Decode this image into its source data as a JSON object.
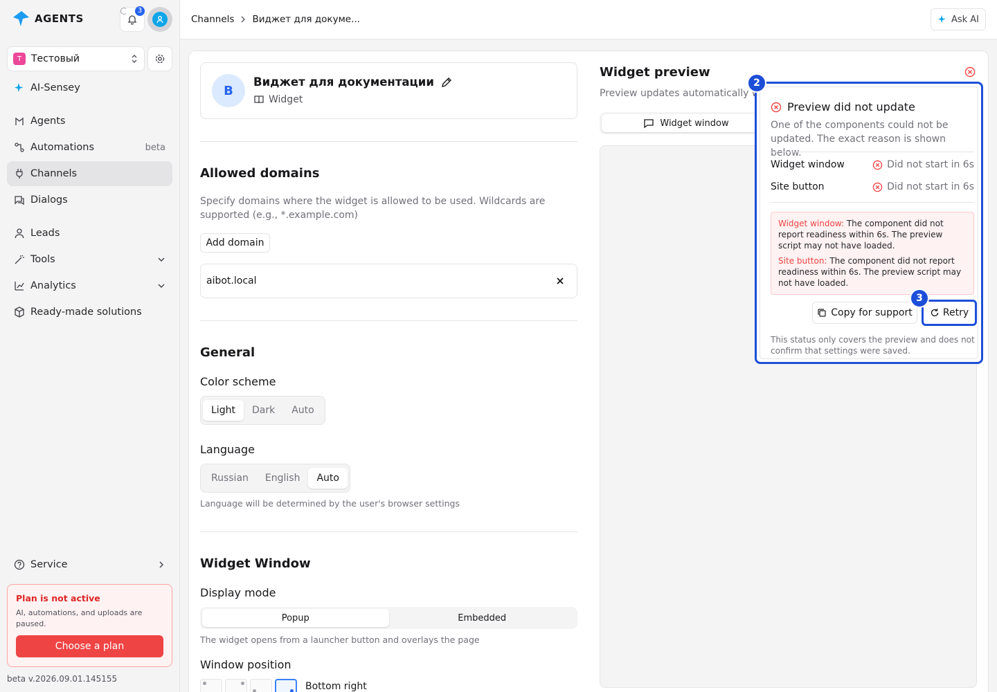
{
  "app": {
    "logo_text": "AGENTS",
    "notifications_count": "3"
  },
  "workspace": {
    "initial": "Т",
    "name": "Тестовый"
  },
  "sidebar": {
    "items": [
      {
        "label": "AI-Sensey",
        "icon": "sparkle-icon"
      },
      {
        "label": "Agents",
        "icon": "agents-icon"
      },
      {
        "label": "Automations",
        "icon": "automations-icon",
        "suffix": "beta"
      },
      {
        "label": "Channels",
        "icon": "channels-icon",
        "active": true
      },
      {
        "label": "Dialogs",
        "icon": "dialogs-icon"
      },
      {
        "label": "Leads",
        "icon": "user-icon"
      },
      {
        "label": "Tools",
        "icon": "wand-icon"
      },
      {
        "label": "Analytics",
        "icon": "chart-icon"
      },
      {
        "label": "Ready-made solutions",
        "icon": "box-icon"
      }
    ],
    "service": "Service",
    "plan": {
      "title": "Plan is not active",
      "description": "AI, automations, and uploads are paused.",
      "button": "Choose a plan"
    },
    "version": "beta v.2026.09.01.145155"
  },
  "header": {
    "breadcrumb_1": "Channels",
    "breadcrumb_2": "Виджет для докуме...",
    "ask_ai": "Ask AI"
  },
  "widget": {
    "avatar_letter": "В",
    "name": "Виджет для документации",
    "type": "Widget"
  },
  "allowed_domains": {
    "title": "Allowed domains",
    "description": "Specify domains where the widget is allowed to be used. Wildcards are supported (e.g., *.example.com)",
    "add_button": "Add domain",
    "domain": "aibot.local"
  },
  "general": {
    "title": "General",
    "color_scheme_label": "Color scheme",
    "color_scheme_options": [
      "Light",
      "Dark",
      "Auto"
    ],
    "color_scheme_selected": "Light",
    "language_label": "Language",
    "language_options": [
      "Russian",
      "English",
      "Auto"
    ],
    "language_selected": "Auto",
    "language_hint": "Language will be determined by the user's browser settings"
  },
  "widget_window": {
    "title": "Widget Window",
    "display_mode_label": "Display mode",
    "display_mode_options": [
      "Popup",
      "Embedded"
    ],
    "display_mode_selected": "Popup",
    "display_mode_hint": "The widget opens from a launcher button and overlays the page",
    "window_position_label": "Window position",
    "window_position_selected": "Bottom right"
  },
  "preview": {
    "title": "Widget preview",
    "subtitle": "Preview updates automatically wh",
    "tab": "Widget window"
  },
  "status_popup": {
    "title": "Preview did not update",
    "description": "One of the components could not be updated. The exact reason is shown below.",
    "rows": [
      {
        "name": "Widget window",
        "status": "Did not start in 6s"
      },
      {
        "name": "Site button",
        "status": "Did not start in 6s"
      }
    ],
    "errors": [
      {
        "label": "Widget window:",
        "text": "The component did not report readiness within 6s. The preview script may not have loaded."
      },
      {
        "label": "Site button:",
        "text": "The component did not report readiness within 6s. The preview script may not have loaded."
      }
    ],
    "copy_button": "Copy for support",
    "retry_button": "Retry",
    "note": "This status only covers the preview and does not confirm that settings were saved."
  },
  "markers": [
    "2",
    "3"
  ],
  "colors": {
    "accent": "#2563eb",
    "error": "#ef4444",
    "highlight": "#1d4ed8"
  }
}
